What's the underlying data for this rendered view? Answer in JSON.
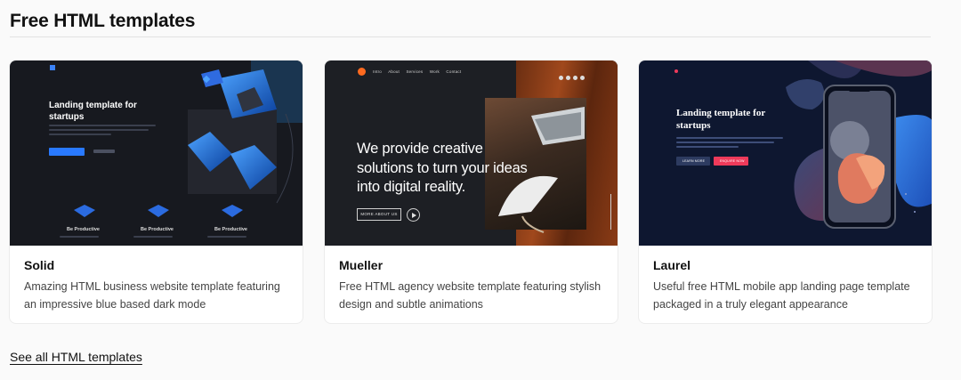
{
  "section": {
    "title": "Free HTML templates",
    "see_all_label": "See all HTML templates"
  },
  "colors": {
    "solid_accent": "#2979ff",
    "mueller_accent": "#ff6a1f",
    "laurel_accent": "#ee3a5a"
  },
  "templates": [
    {
      "name": "Solid",
      "description": "Amazing HTML business website template featuring an impressive blue based dark mode",
      "preview": {
        "hero_title": "Landing template for startups",
        "features": [
          "Be Productive",
          "Be Productive",
          "Be Productive"
        ]
      }
    },
    {
      "name": "Mueller",
      "description": "Free HTML agency website template featuring stylish design and subtle animations",
      "preview": {
        "nav": [
          "Intro",
          "About",
          "Services",
          "Work",
          "Contact"
        ],
        "headline": "We provide creative solutions to turn your ideas into digital reality.",
        "button_label": "MORE ABOUT US"
      }
    },
    {
      "name": "Laurel",
      "description": "Useful free HTML mobile app landing page template packaged in a truly elegant appearance",
      "preview": {
        "hero_title": "Landing template for startups",
        "primary_button": "LEARN MORE",
        "secondary_button": "ENQUIRE NOW"
      }
    }
  ]
}
